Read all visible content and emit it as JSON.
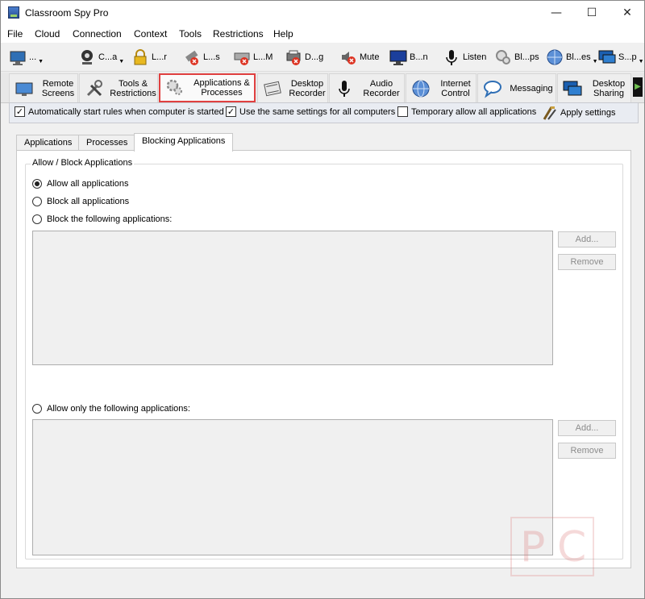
{
  "window": {
    "title": "Classroom Spy Pro",
    "minimize": "—",
    "maximize": "☐",
    "close": "✕"
  },
  "menu": [
    "File",
    "Cloud",
    "Connection",
    "Context",
    "Tools",
    "Restrictions",
    "Help"
  ],
  "toolbar": {
    "items": [
      {
        "label": "...",
        "icon": "monitor-icon"
      },
      {
        "label": "C...a",
        "icon": "webcam-icon"
      },
      {
        "label": "L...r",
        "icon": "lock-icon"
      },
      {
        "label": "L...s",
        "icon": "usb-block-icon"
      },
      {
        "label": "L...M",
        "icon": "drive-block-icon"
      },
      {
        "label": "D...g",
        "icon": "printer-block-icon"
      },
      {
        "label": "Mute",
        "icon": "speaker-mute-icon"
      },
      {
        "label": "B...n",
        "icon": "black-screen-icon"
      },
      {
        "label": "Listen",
        "icon": "microphone-icon"
      },
      {
        "label": "Bl...ps",
        "icon": "block-apps-icon"
      },
      {
        "label": "Bl...es",
        "icon": "block-web-icon"
      },
      {
        "label": "S...p",
        "icon": "screen-share-icon"
      }
    ]
  },
  "tabs": [
    {
      "line1": "Remote",
      "line2": "Screens",
      "icon": "remote-screens-icon"
    },
    {
      "line1": "Tools &",
      "line2": "Restrictions",
      "icon": "tools-icon"
    },
    {
      "line1": "Applications &",
      "line2": "Processes",
      "icon": "gears-icon"
    },
    {
      "line1": "Desktop",
      "line2": "Recorder",
      "icon": "film-icon"
    },
    {
      "line1": "Audio",
      "line2": "Recorder",
      "icon": "microphone-icon"
    },
    {
      "line1": "Internet",
      "line2": "Control",
      "icon": "globe-icon"
    },
    {
      "line1": "Messaging",
      "line2": "",
      "icon": "chat-bubble-icon"
    },
    {
      "line1": "Desktop",
      "line2": "Sharing",
      "icon": "desktop-share-icon"
    }
  ],
  "options": {
    "auto_start": "Automatically start rules when computer is started",
    "same_settings": "Use the same settings for all computers",
    "temp_allow": "Temporary allow all applications",
    "apply": "Apply settings",
    "auto_start_checked": true,
    "same_settings_checked": true,
    "temp_allow_checked": false
  },
  "subtabs": [
    "Applications",
    "Processes",
    "Blocking Applications"
  ],
  "group": {
    "label": "Allow / Block Applications",
    "allow_all": "Allow all applications",
    "block_all": "Block all applications",
    "block_following": "Block the following applications:",
    "allow_only": "Allow only the following applications:",
    "add": "Add...",
    "remove": "Remove",
    "selected": "allow_all"
  },
  "colors": {
    "active_tab_border": "#e04040",
    "accent": "#1e5fb4"
  }
}
